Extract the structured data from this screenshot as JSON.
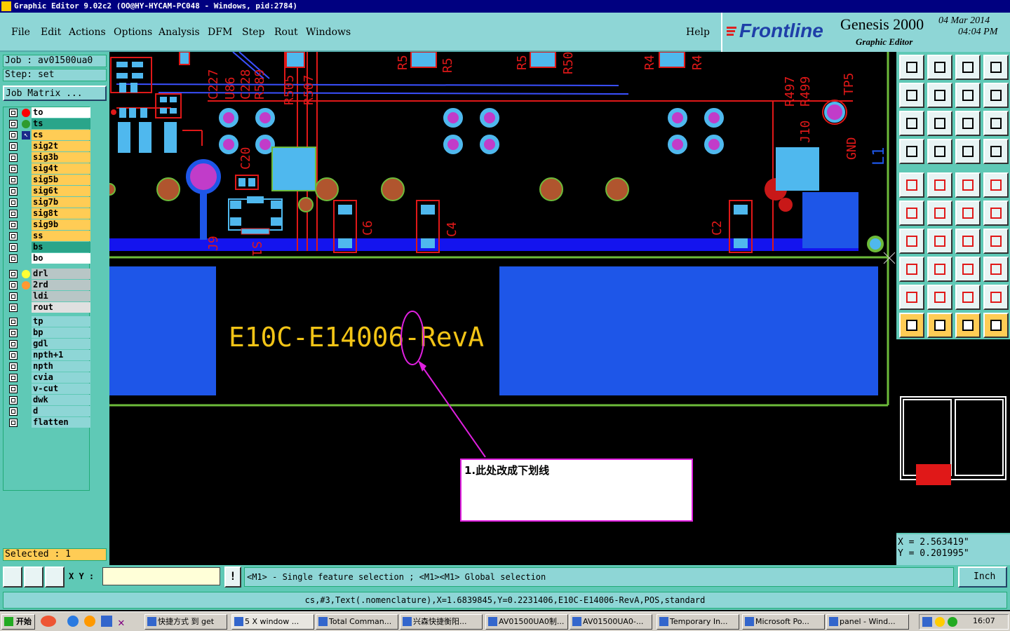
{
  "window": {
    "title": "Graphic Editor 9.02c2 (OO@HY-HYCAM-PC048 - Windows, pid:2784)"
  },
  "menu": [
    "File",
    "Edit",
    "Actions",
    "Options",
    "Analysis",
    "DFM",
    "Step",
    "Rout",
    "Windows"
  ],
  "help_label": "Help",
  "brand": {
    "logo": "Frontline",
    "product": "Genesis 2000",
    "subtitle": "Graphic Editor",
    "date": "04 Mar 2014",
    "time": "04:04 PM"
  },
  "job": {
    "job_label": "Job : av01500ua0",
    "step_label": "Step: set",
    "matrix_button": "Job Matrix ..."
  },
  "layers_board": [
    {
      "name": "to",
      "bg": "#ffffff",
      "dot": "#ff0000"
    },
    {
      "name": "ts",
      "bg": "#2aa58a",
      "dot": "#2e9b2e"
    },
    {
      "name": "cs",
      "bg": "#ffcc55",
      "dot": "arrow"
    },
    {
      "name": "sig2t",
      "bg": "#ffcc55"
    },
    {
      "name": "sig3b",
      "bg": "#ffcc55"
    },
    {
      "name": "sig4t",
      "bg": "#ffcc55"
    },
    {
      "name": "sig5b",
      "bg": "#ffcc55"
    },
    {
      "name": "sig6t",
      "bg": "#ffcc55"
    },
    {
      "name": "sig7b",
      "bg": "#ffcc55"
    },
    {
      "name": "sig8t",
      "bg": "#ffcc55"
    },
    {
      "name": "sig9b",
      "bg": "#ffcc55"
    },
    {
      "name": "ss",
      "bg": "#ffcc55"
    },
    {
      "name": "bs",
      "bg": "#2aa58a"
    },
    {
      "name": "bo",
      "bg": "#ffffff"
    }
  ],
  "layers_drill": [
    {
      "name": "drl",
      "bg": "#b8c6c6",
      "dot": "#ffff33"
    },
    {
      "name": "2rd",
      "bg": "#b8c6c6",
      "dot": "#ff9933"
    },
    {
      "name": "ldi",
      "bg": "#b8c6c6"
    },
    {
      "name": "rout",
      "bg": "#e0e0e0"
    }
  ],
  "layers_misc": [
    "tp",
    "bp",
    "gdl",
    "npth+1",
    "npth",
    "cvia",
    "v-cut",
    "dwk",
    "d",
    "flatten"
  ],
  "selected": "Selected : 1",
  "board": {
    "text": "E10C-E14006-RevA",
    "refdes_top": [
      "C227",
      "U86",
      "C228",
      "R589",
      "R505",
      "R507",
      "R5",
      "R5",
      "R5",
      "R50",
      "R4",
      "R4",
      "R497",
      "R499",
      "TP5",
      "J10",
      "GND",
      "L1"
    ],
    "refdes_mid": [
      "C20",
      "J9",
      "S1",
      "C6",
      "C4",
      "C2"
    ]
  },
  "annotation": {
    "text": "1.此处改成下划线"
  },
  "coords": {
    "x": "X = 2.563419\"",
    "y": "Y = 0.201995\""
  },
  "command": {
    "xy_label": "X Y :",
    "xy_value": "",
    "message": "<M1> - Single feature selection ; <M1><M1> Global selection",
    "units": "Inch"
  },
  "status_line": "cs,#3,Text(.nomenclature),X=1.6839845,Y=0.2231406,E10C-E14006-RevA,POS,standard",
  "taskbar": {
    "start": "开始",
    "items": [
      "快捷方式 到 get",
      "5 X window ...",
      "Total Comman...",
      "兴森快捷衡阳...",
      "AV01500UA0制...",
      "AV01500UA0-...",
      "Temporary In...",
      "Microsoft Po...",
      "panel - Wind..."
    ],
    "clock": "16:07"
  }
}
